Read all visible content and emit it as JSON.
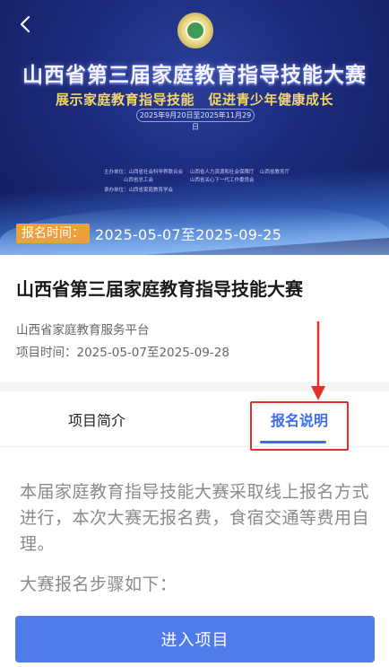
{
  "banner": {
    "title": "山西省第三届家庭教育指导技能大赛",
    "subtitle": "展示家庭教育指导技能　促进青少年健康成长",
    "date_range": "2025年9月20日至2025年11月29日",
    "organizers": [
      "主办单位：山西省社会科学界联合会",
      "山西省人力资源和社会保障厅",
      "山西省教育厅",
      "山西省总工会",
      "山西省关心下一代工作委员会",
      "承办单位：山西省家庭教育学会"
    ],
    "registration_label": "报名时间：",
    "registration_value": "2025-05-07至2025-09-25"
  },
  "project": {
    "title": "山西省第三届家庭教育指导技能大赛",
    "organizer": "山西省家庭教育服务平台",
    "time": "项目时间：2025-05-07至2025-09-28"
  },
  "tabs": [
    {
      "label": "项目简介",
      "active": false
    },
    {
      "label": "报名说明",
      "active": true
    }
  ],
  "content": {
    "paragraph1": "本届家庭教育指导技能大赛采取线上报名方式进行，本次大赛无报名费，食宿交通等费用自理。",
    "paragraph2": "大赛报名步骤如下："
  },
  "footer": {
    "enter_button": "进入项目"
  },
  "colors": {
    "accent": "#3b6ee8",
    "button": "#4f7ce8",
    "badge": "#e9a13b",
    "annotation": "#e3322b"
  },
  "icons": {
    "back": "chevron-left-icon",
    "logo": "contest-emblem-icon"
  }
}
